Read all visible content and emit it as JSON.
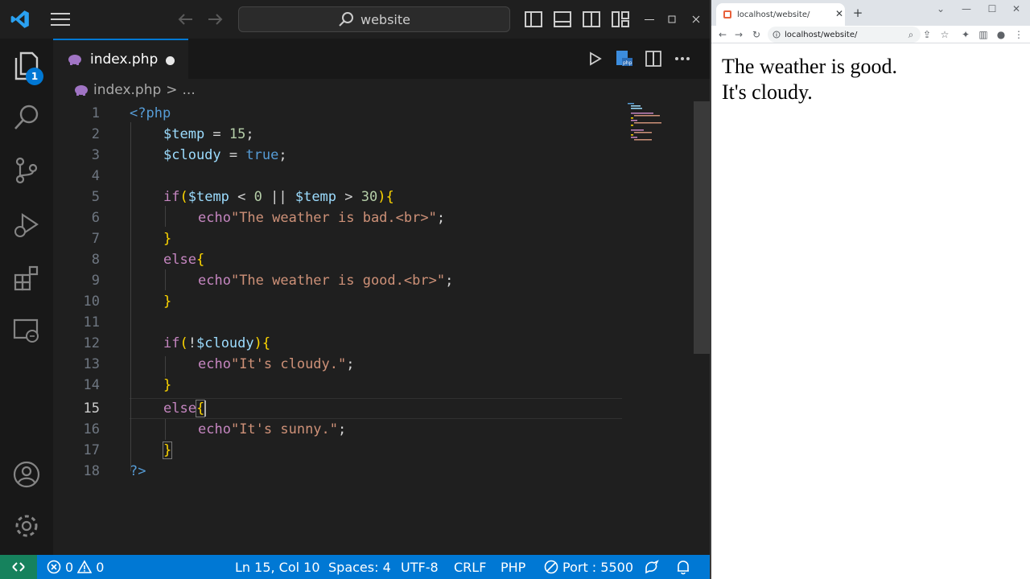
{
  "titlebar": {
    "search_text": "website"
  },
  "activity": {
    "explorer_badge": "1"
  },
  "tab": {
    "filename": "index.php"
  },
  "breadcrumb": {
    "file": "index.php",
    "separator": ">",
    "rest": "..."
  },
  "editor": {
    "lines": [
      {
        "n": "1"
      },
      {
        "n": "2"
      },
      {
        "n": "3"
      },
      {
        "n": "4"
      },
      {
        "n": "5"
      },
      {
        "n": "6"
      },
      {
        "n": "7"
      },
      {
        "n": "8"
      },
      {
        "n": "9"
      },
      {
        "n": "10"
      },
      {
        "n": "11"
      },
      {
        "n": "12"
      },
      {
        "n": "13"
      },
      {
        "n": "14"
      },
      {
        "n": "15"
      },
      {
        "n": "16"
      },
      {
        "n": "17"
      },
      {
        "n": "18"
      }
    ],
    "tokens": {
      "open_tag": "<?php",
      "temp_var": "$temp",
      "assign": " = ",
      "temp_val": "15",
      "semi": ";",
      "cloudy_var": "$cloudy",
      "cloudy_val": "true",
      "if_kw": "if",
      "paren_open": "(",
      "lt": " < ",
      "zero": "0",
      "or": " || ",
      "gt": " > ",
      "thirty": "30",
      "paren_close": ")",
      "brace_open": "{",
      "brace_close": "}",
      "echo_kw": "echo",
      "str_bad": "\"The weather is bad.<br>\"",
      "else_kw": "else",
      "str_good": "\"The weather is good.<br>\"",
      "not": "!",
      "str_cloudy": "\"It's cloudy.\"",
      "str_sunny": "\"It's sunny.\"",
      "close_tag": "?>"
    }
  },
  "statusbar": {
    "errors": "0",
    "warnings": "0",
    "position": "Ln 15, Col 10",
    "spaces": "Spaces: 4",
    "encoding": "UTF-8",
    "eol": "CRLF",
    "language": "PHP",
    "port": "Port : 5500"
  },
  "browser": {
    "tab_title": "localhost/website/",
    "url": "localhost/website/",
    "content_lines": [
      "The weather is good.",
      "It's cloudy."
    ]
  },
  "colors": {
    "accent": "#0078d4",
    "remote": "#16825d"
  }
}
